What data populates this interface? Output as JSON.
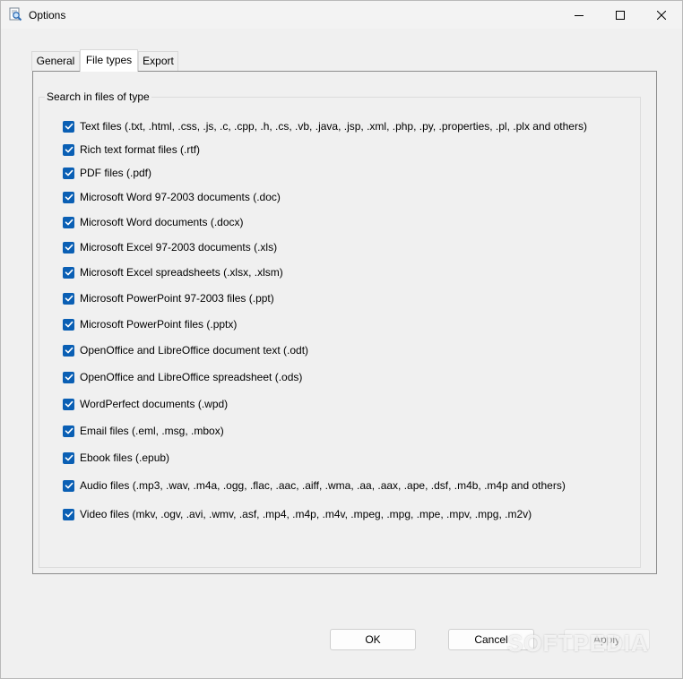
{
  "window": {
    "title": "Options"
  },
  "tabs": [
    {
      "label": "General",
      "active": false
    },
    {
      "label": "File types",
      "active": true
    },
    {
      "label": "Export",
      "active": false
    }
  ],
  "group": {
    "label": "Search in files of type",
    "items": [
      {
        "label": "Text files (.txt, .html, .css, .js, .c, .cpp, .h, .cs, .vb, .java, .jsp, .xml, .php, .py, .properties, .pl, .plx and others)",
        "checked": true
      },
      {
        "label": "Rich text format files (.rtf)",
        "checked": true
      },
      {
        "label": "PDF files (.pdf)",
        "checked": true
      },
      {
        "label": "Microsoft Word 97-2003 documents (.doc)",
        "checked": true
      },
      {
        "label": "Microsoft Word documents (.docx)",
        "checked": true
      },
      {
        "label": "Microsoft Excel 97-2003 documents (.xls)",
        "checked": true
      },
      {
        "label": "Microsoft Excel spreadsheets (.xlsx, .xlsm)",
        "checked": true
      },
      {
        "label": "Microsoft PowerPoint 97-2003 files (.ppt)",
        "checked": true
      },
      {
        "label": "Microsoft PowerPoint files (.pptx)",
        "checked": true
      },
      {
        "label": "OpenOffice and LibreOffice document text (.odt)",
        "checked": true
      },
      {
        "label": "OpenOffice and LibreOffice spreadsheet (.ods)",
        "checked": true
      },
      {
        "label": "WordPerfect documents (.wpd)",
        "checked": true
      },
      {
        "label": "Email files (.eml, .msg, .mbox)",
        "checked": true
      },
      {
        "label": "Ebook files (.epub)",
        "checked": true
      },
      {
        "label": "Audio files (.mp3, .wav, .m4a, .ogg, .flac, .aac, .aiff, .wma, .aa, .aax, .ape, .dsf, .m4b, .m4p and others)",
        "checked": true
      },
      {
        "label": "Video files (mkv, .ogv, .avi, .wmv, .asf, .mp4, .m4p, .m4v, .mpeg, .mpg, .mpe, .mpv, .mpg, .m2v)",
        "checked": true
      }
    ]
  },
  "buttons": {
    "ok": "OK",
    "cancel": "Cancel",
    "apply": "Apply"
  },
  "watermark": "SOFTPEDIA",
  "colors": {
    "checkbox_accent": "#0a5fb4",
    "window_bg": "#f0f0f0"
  }
}
